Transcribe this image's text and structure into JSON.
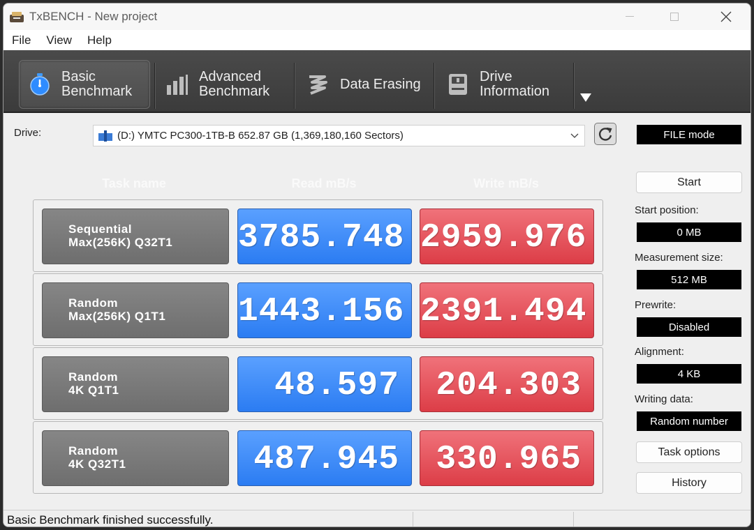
{
  "window": {
    "title": "TxBENCH - New project"
  },
  "menu": [
    "File",
    "View",
    "Help"
  ],
  "tabs": [
    {
      "line1": "Basic",
      "line2": "Benchmark",
      "icon": "stopwatch-icon",
      "active": true
    },
    {
      "line1": "Advanced",
      "line2": "Benchmark",
      "icon": "bar-chart-icon",
      "active": false
    },
    {
      "line1": "Data Erasing",
      "line2": "",
      "icon": "eraser-icon",
      "active": false
    },
    {
      "line1": "Drive",
      "line2": "Information",
      "icon": "drive-info-icon",
      "active": false
    }
  ],
  "drive": {
    "label": "Drive:",
    "value": "(D:) YMTC PC300-1TB-B  652.87 GB (1,369,180,160 Sectors)"
  },
  "headers": {
    "task": "Task name",
    "read": "Read mB/s",
    "write": "Write mB/s"
  },
  "rows": [
    {
      "line1": "Sequential",
      "line2": "Max(256K) Q32T1",
      "read": "3785.748",
      "write": "2959.976"
    },
    {
      "line1": "Random",
      "line2": "Max(256K) Q1T1",
      "read": "1443.156",
      "write": "2391.494"
    },
    {
      "line1": "Random",
      "line2": "4K Q1T1",
      "read": "48.597",
      "write": "204.303"
    },
    {
      "line1": "Random",
      "line2": "4K Q32T1",
      "read": "487.945",
      "write": "330.965"
    }
  ],
  "panel": {
    "mode": "FILE mode",
    "start_label": "Start",
    "start_position_label": "Start position:",
    "start_position": "0 MB",
    "measurement_size_label": "Measurement size:",
    "measurement_size": "512 MB",
    "prewrite_label": "Prewrite:",
    "prewrite": "Disabled",
    "alignment_label": "Alignment:",
    "alignment": "4 KB",
    "writing_data_label": "Writing data:",
    "writing_data": "Random number",
    "task_options_label": "Task options",
    "history_label": "History"
  },
  "status": {
    "text": "Basic Benchmark finished successfully."
  },
  "colors": {
    "read": "#2b7cf2",
    "write": "#dc3d47",
    "task": "#7a7a7a"
  }
}
